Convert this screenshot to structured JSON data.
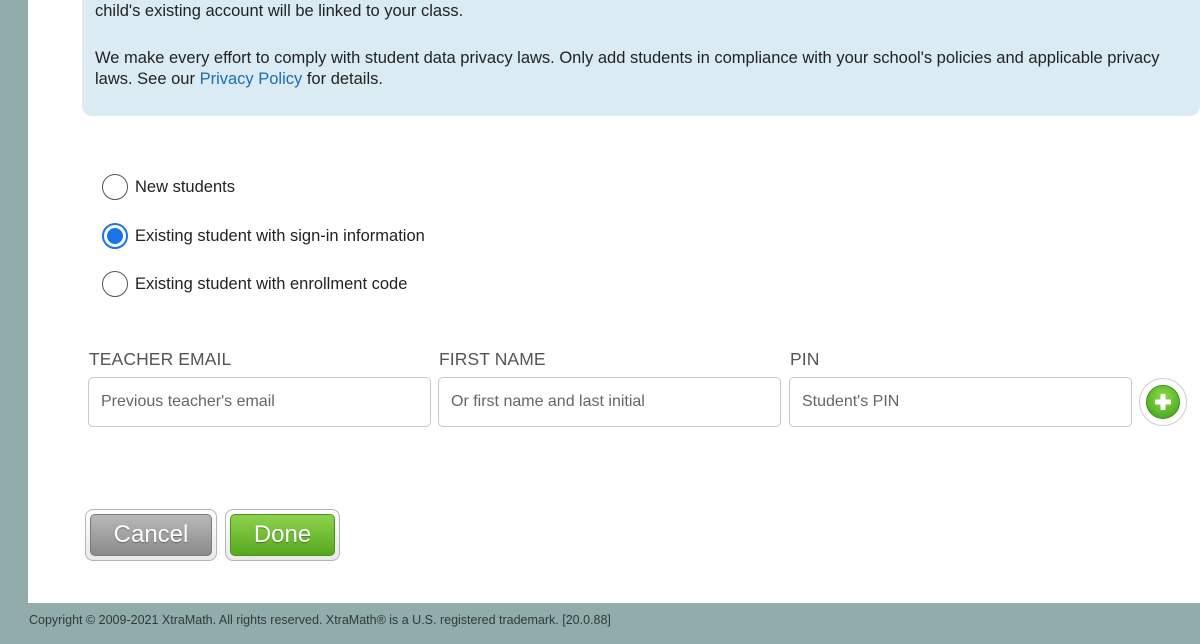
{
  "info": {
    "paragraph1": "Don't worry if your students already have accounts. Create new accounts and send home parent flyers. When parents follow the instructions, their child's existing account will be linked to your class.",
    "paragraph2_before": "We make every effort to comply with student data privacy laws. Only add students in compliance with your school's policies and applicable privacy laws. See our ",
    "privacy_link": "Privacy Policy",
    "paragraph2_after": " for details."
  },
  "options": [
    {
      "label": "New students",
      "selected": false
    },
    {
      "label": "Existing student with sign-in information",
      "selected": true
    },
    {
      "label": "Existing student with enrollment code",
      "selected": false
    }
  ],
  "form": {
    "teacher_email_label": "TEACHER EMAIL",
    "teacher_email_placeholder": "Previous teacher's email",
    "teacher_email_value": "",
    "first_name_label": "FIRST NAME",
    "first_name_placeholder": "Or first name and last initial",
    "first_name_value": "",
    "pin_label": "PIN",
    "pin_placeholder": "Student's PIN",
    "pin_value": ""
  },
  "buttons": {
    "cancel": "Cancel",
    "done": "Done",
    "add_icon": "plus-circle-icon"
  },
  "colors": {
    "accent_green": "#5cb82a",
    "radio_blue": "#1a73e8",
    "info_bg": "#dbebf4",
    "page_bg": "#92acab"
  },
  "footer": {
    "copyright": "Copyright © 2009-2021 XtraMath. All rights reserved. XtraMath® is a U.S. registered trademark. [20.0.88]"
  }
}
